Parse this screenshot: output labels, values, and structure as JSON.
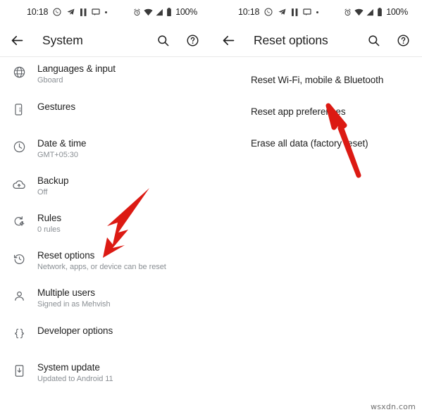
{
  "colors": {
    "arrow_red": "#DC1A13",
    "text_primary": "#1f1f1f",
    "text_secondary": "#8a8f94",
    "icon_stroke": "#5f6368",
    "divider": "#e8e8e8",
    "background": "#ffffff"
  },
  "status_bar": {
    "time": "10:18",
    "battery_percent": "100%",
    "left_icons": [
      "whatsapp-icon",
      "telegram-icon",
      "pause-icon",
      "message-icon",
      "more-dot-icon"
    ],
    "right_icons": [
      "alarm-icon",
      "wifi-icon",
      "signal-icon",
      "battery-icon"
    ]
  },
  "left_panel": {
    "app_bar": {
      "back_label": "back-arrow-icon",
      "title": "System",
      "actions": [
        "search-icon",
        "help-icon"
      ]
    },
    "items": [
      {
        "icon": "globe-icon",
        "title": "Languages & input",
        "subtitle": "Gboard"
      },
      {
        "icon": "gesture-phone-icon",
        "title": "Gestures",
        "subtitle": ""
      },
      {
        "icon": "clock-icon",
        "title": "Date & time",
        "subtitle": "GMT+05:30"
      },
      {
        "icon": "cloud-upload-icon",
        "title": "Backup",
        "subtitle": "Off"
      },
      {
        "icon": "rules-icon",
        "title": "Rules",
        "subtitle": "0 rules"
      },
      {
        "icon": "restore-icon",
        "title": "Reset options",
        "subtitle": "Network, apps, or device can be reset"
      },
      {
        "icon": "person-icon",
        "title": "Multiple users",
        "subtitle": "Signed in as Mehvish"
      },
      {
        "icon": "braces-icon",
        "title": "Developer options",
        "subtitle": ""
      },
      {
        "icon": "system-update-icon",
        "title": "System update",
        "subtitle": "Updated to Android 11"
      }
    ]
  },
  "right_panel": {
    "app_bar": {
      "back_label": "back-arrow-icon",
      "title": "Reset options",
      "actions": [
        "search-icon",
        "help-icon"
      ]
    },
    "items": [
      {
        "title": "Reset Wi-Fi, mobile & Bluetooth"
      },
      {
        "title": "Reset app preferences"
      },
      {
        "title": "Erase all data (factory reset)"
      }
    ]
  },
  "annotations": [
    {
      "name": "arrow-to-reset-options",
      "target": "Reset options"
    },
    {
      "name": "arrow-to-reset-app-preferences",
      "target": "Reset app preferences"
    }
  ],
  "watermark": {
    "text": "wsxdn.com"
  }
}
